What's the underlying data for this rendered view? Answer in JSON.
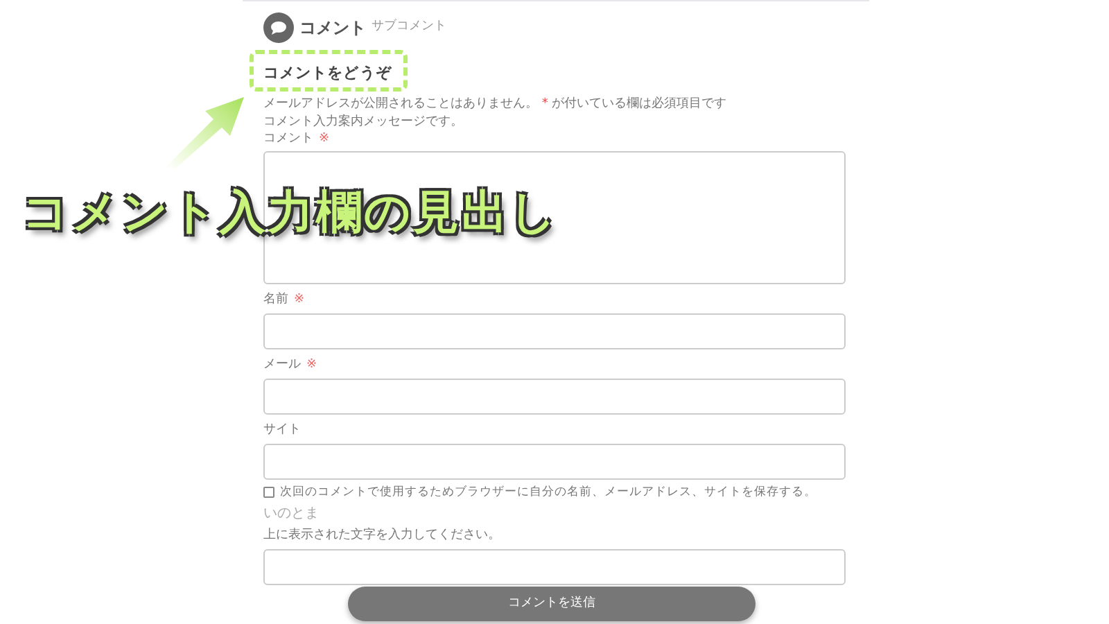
{
  "section": {
    "title": "コメント",
    "subtitle": "サブコメント"
  },
  "form": {
    "heading": "コメントをどうぞ",
    "notes": {
      "before": "メールアドレスが公開されることはありません。",
      "mark": "*",
      "after": "が付いている欄は必須項目です"
    },
    "message": "コメント入力案内メッセージです。",
    "fields": [
      {
        "label": "コメント",
        "required_mark": "※",
        "kind": "textarea"
      },
      {
        "label": "名前",
        "required_mark": "※",
        "kind": "input"
      },
      {
        "label": "メール",
        "required_mark": "※",
        "kind": "input"
      },
      {
        "label": "サイト",
        "kind": "input"
      }
    ],
    "save_consent": {
      "label": "次回のコメントで使用するためブラウザーに自分の名前、メールアドレス、サイトを保存する。",
      "checked": false
    },
    "captcha": {
      "text": "いのとま",
      "prompt": "上に表示された文字を入力してください。"
    },
    "submit": "コメントを送信"
  },
  "annotation": {
    "text": "コメント入力欄の見出し"
  }
}
